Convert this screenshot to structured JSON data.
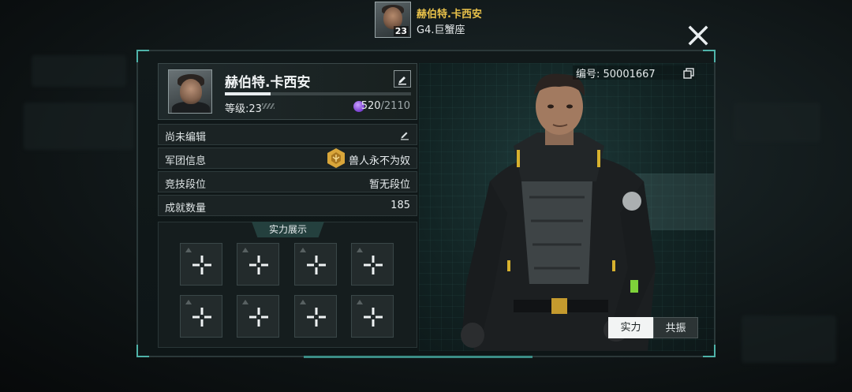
{
  "header": {
    "player_name": "赫伯特.卡西安",
    "player_level": "23",
    "server_sign": "G4.巨蟹座"
  },
  "profile": {
    "name": "赫伯特.卡西安",
    "level_label": "等级:23",
    "exp_current": "520",
    "exp_separator": "/",
    "exp_max": "2110",
    "exp_fraction": 0.246,
    "player_id": "编号: 50001667"
  },
  "info_rows": {
    "signature": "尚未编辑",
    "legion_label": "军团信息",
    "legion_value": "兽人永不为奴",
    "arena_label": "竞技段位",
    "arena_value": "暂无段位",
    "achievement_label": "成就数量",
    "achievement_value": "185"
  },
  "showcase": {
    "title": "实力展示"
  },
  "tabs": {
    "strength": "实力",
    "resonance": "共振"
  },
  "colors": {
    "accent": "#4fb3a9",
    "gold_name": "#e9c24a",
    "legion_badge": "#d9a63a",
    "exp_gem": "#8e4fe0"
  },
  "icons": [
    "close-icon",
    "edit-icon",
    "pencil-icon",
    "copy-icon",
    "plus-icon",
    "legion-badge-icon",
    "exp-gem-icon"
  ]
}
